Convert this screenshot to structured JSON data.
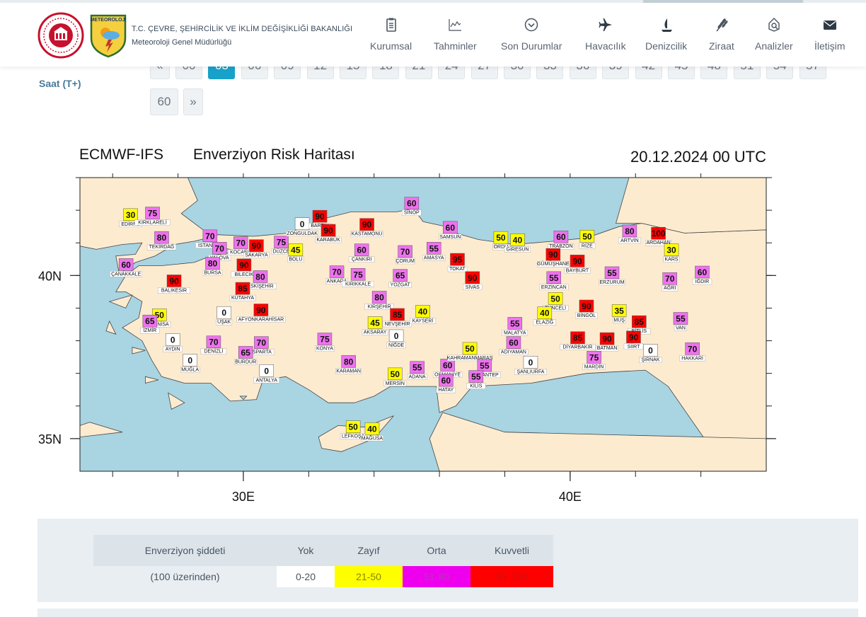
{
  "header": {
    "org_line1": "T.C. ÇEVRE, ŞEHİRCİLİK VE İKLİM DEĞİŞİKLİĞİ BAKANLIĞI",
    "org_line2": "Meteoroloji Genel Müdürlüğü",
    "logo2_text": "METEOROLOJİ",
    "nav": [
      {
        "label": "Kurumsal",
        "icon": "clipboard-icon"
      },
      {
        "label": "Tahminler",
        "icon": "chart-icon"
      },
      {
        "label": "Son Durumlar",
        "icon": "chevron-circle-icon"
      },
      {
        "label": "Havacılık",
        "icon": "airplane-icon"
      },
      {
        "label": "Denizcilik",
        "icon": "sailboat-icon"
      },
      {
        "label": "Ziraat",
        "icon": "wheat-icon"
      },
      {
        "label": "Analizler",
        "icon": "magnifier-icon"
      },
      {
        "label": "İletişim",
        "icon": "envelope-icon"
      }
    ]
  },
  "pager": {
    "label": "Saat (T+)",
    "prev": "«",
    "next": "»",
    "hours": [
      "00",
      "03",
      "06",
      "09",
      "12",
      "15",
      "18",
      "21",
      "24",
      "27",
      "30",
      "33",
      "36",
      "39",
      "42",
      "45",
      "48",
      "51",
      "54",
      "57",
      "60"
    ],
    "active": "03"
  },
  "map": {
    "model": "ECMWF-IFS",
    "title": "Enverziyon Risk Haritası",
    "datetime": "20.12.2024 00 UTC",
    "lat_labels": [
      "40N",
      "35N"
    ],
    "lon_labels": [
      "30E",
      "40E"
    ],
    "colors": {
      "sea": "#a9d4e2",
      "land": "#fdebd0",
      "yok": "#ffffff",
      "zayif": "#ffff00",
      "orta": "#ee72ee",
      "kuvvetli": "#ff0000"
    },
    "stations": [
      {
        "name": "EDİRNE",
        "v": 30,
        "lon": 26.55,
        "lat": 41.68
      },
      {
        "name": "KIRKLARELİ",
        "v": 75,
        "lon": 27.22,
        "lat": 41.73
      },
      {
        "name": "TEKİRDAĞ",
        "v": 80,
        "lon": 27.5,
        "lat": 40.98
      },
      {
        "name": "İSTANBUL",
        "v": 70,
        "lon": 28.98,
        "lat": 41.03
      },
      {
        "name": "YALOVA",
        "v": 70,
        "lon": 29.27,
        "lat": 40.65
      },
      {
        "name": "KOCAELİ",
        "v": 70,
        "lon": 29.92,
        "lat": 40.82
      },
      {
        "name": "SAKARYA",
        "v": 90,
        "lon": 30.4,
        "lat": 40.73
      },
      {
        "name": "DÜZCE",
        "v": 75,
        "lon": 31.16,
        "lat": 40.84
      },
      {
        "name": "BOLU",
        "v": 45,
        "lon": 31.6,
        "lat": 40.6
      },
      {
        "name": "ZONGULDAK",
        "v": 0,
        "lon": 31.8,
        "lat": 41.4
      },
      {
        "name": "BARTIN",
        "v": 90,
        "lon": 32.34,
        "lat": 41.63
      },
      {
        "name": "KARABÜK",
        "v": 90,
        "lon": 32.6,
        "lat": 41.2
      },
      {
        "name": "KASTAMONU",
        "v": 90,
        "lon": 33.78,
        "lat": 41.38
      },
      {
        "name": "SİNOP",
        "v": 60,
        "lon": 35.15,
        "lat": 42.03
      },
      {
        "name": "ÇANAKKALE",
        "v": 60,
        "lon": 26.41,
        "lat": 40.15
      },
      {
        "name": "BALIKESİR",
        "v": 90,
        "lon": 27.88,
        "lat": 39.65
      },
      {
        "name": "BURSA",
        "v": 80,
        "lon": 29.06,
        "lat": 40.19
      },
      {
        "name": "BİLECİK",
        "v": 90,
        "lon": 30.02,
        "lat": 40.14
      },
      {
        "name": "ESKİŞEHİR",
        "v": 80,
        "lon": 30.52,
        "lat": 39.78
      },
      {
        "name": "KÜTAHYA",
        "v": 85,
        "lon": 29.98,
        "lat": 39.42
      },
      {
        "name": "ÇANKIRI",
        "v": 60,
        "lon": 33.62,
        "lat": 40.6
      },
      {
        "name": "ÇORUM",
        "v": 70,
        "lon": 34.95,
        "lat": 40.55
      },
      {
        "name": "AMASYA",
        "v": 55,
        "lon": 35.83,
        "lat": 40.65
      },
      {
        "name": "SAMSUN",
        "v": 60,
        "lon": 36.33,
        "lat": 41.29
      },
      {
        "name": "TOKAT",
        "v": 95,
        "lon": 36.55,
        "lat": 40.31
      },
      {
        "name": "ANKARA",
        "v": 70,
        "lon": 32.86,
        "lat": 39.93
      },
      {
        "name": "KIRIKKALE",
        "v": 75,
        "lon": 33.51,
        "lat": 39.85
      },
      {
        "name": "YOZGAT",
        "v": 65,
        "lon": 34.8,
        "lat": 39.82
      },
      {
        "name": "SİVAS",
        "v": 90,
        "lon": 37.01,
        "lat": 39.75
      },
      {
        "name": "ORDU",
        "v": 50,
        "lon": 37.88,
        "lat": 40.98
      },
      {
        "name": "GİRESUN",
        "v": 40,
        "lon": 38.39,
        "lat": 40.91
      },
      {
        "name": "TRABZON",
        "v": 60,
        "lon": 39.72,
        "lat": 41.0
      },
      {
        "name": "RİZE",
        "v": 50,
        "lon": 40.52,
        "lat": 41.02
      },
      {
        "name": "ARTVİN",
        "v": 80,
        "lon": 41.82,
        "lat": 41.18
      },
      {
        "name": "ARDAHAN",
        "v": 100,
        "lon": 42.7,
        "lat": 41.11
      },
      {
        "name": "KARS",
        "v": 30,
        "lon": 43.1,
        "lat": 40.6
      },
      {
        "name": "GÜMÜŞHANE",
        "v": 90,
        "lon": 39.48,
        "lat": 40.46
      },
      {
        "name": "BAYBURT",
        "v": 90,
        "lon": 40.22,
        "lat": 40.26
      },
      {
        "name": "ERZİNCAN",
        "v": 55,
        "lon": 39.5,
        "lat": 39.75
      },
      {
        "name": "ERZURUM",
        "v": 55,
        "lon": 41.28,
        "lat": 39.9
      },
      {
        "name": "IĞDIR",
        "v": 60,
        "lon": 44.04,
        "lat": 39.92
      },
      {
        "name": "AĞRI",
        "v": 70,
        "lon": 43.05,
        "lat": 39.72
      },
      {
        "name": "TUNCELİ",
        "v": 50,
        "lon": 39.55,
        "lat": 39.11
      },
      {
        "name": "BİNGÖL",
        "v": 90,
        "lon": 40.5,
        "lat": 38.88
      },
      {
        "name": "MUŞ",
        "v": 35,
        "lon": 41.5,
        "lat": 38.74
      },
      {
        "name": "BİTLİS",
        "v": 85,
        "lon": 42.11,
        "lat": 38.4
      },
      {
        "name": "VAN",
        "v": 55,
        "lon": 43.38,
        "lat": 38.5
      },
      {
        "name": "ELAZIĞ",
        "v": 40,
        "lon": 39.22,
        "lat": 38.67
      },
      {
        "name": "MALATYA",
        "v": 55,
        "lon": 38.31,
        "lat": 38.35
      },
      {
        "name": "KIRŞEHİR",
        "v": 80,
        "lon": 34.16,
        "lat": 39.15
      },
      {
        "name": "NEVŞEHİR",
        "v": 85,
        "lon": 34.71,
        "lat": 38.62
      },
      {
        "name": "KAYSERİ",
        "v": 40,
        "lon": 35.49,
        "lat": 38.72
      },
      {
        "name": "AKSARAY",
        "v": 45,
        "lon": 34.03,
        "lat": 38.37
      },
      {
        "name": "NİĞDE",
        "v": 0,
        "lon": 34.68,
        "lat": 37.97
      },
      {
        "name": "AFYONKARAHİSAR",
        "v": 90,
        "lon": 30.54,
        "lat": 38.76
      },
      {
        "name": "UŞAK",
        "v": 0,
        "lon": 29.41,
        "lat": 38.68
      },
      {
        "name": "MANİSA",
        "v": 50,
        "lon": 27.43,
        "lat": 38.61
      },
      {
        "name": "İZMİR",
        "v": 65,
        "lon": 27.14,
        "lat": 38.42
      },
      {
        "name": "AYDIN",
        "v": 0,
        "lon": 27.84,
        "lat": 37.85
      },
      {
        "name": "DENİZLİ",
        "v": 70,
        "lon": 29.09,
        "lat": 37.78
      },
      {
        "name": "ISPARTA",
        "v": 70,
        "lon": 30.55,
        "lat": 37.76
      },
      {
        "name": "BURDUR",
        "v": 65,
        "lon": 30.07,
        "lat": 37.46
      },
      {
        "name": "MUĞLA",
        "v": 0,
        "lon": 28.37,
        "lat": 37.22
      },
      {
        "name": "ANTALYA",
        "v": 0,
        "lon": 30.71,
        "lat": 36.9
      },
      {
        "name": "KONYA",
        "v": 75,
        "lon": 32.49,
        "lat": 37.87
      },
      {
        "name": "KARAMAN",
        "v": 80,
        "lon": 33.22,
        "lat": 37.18
      },
      {
        "name": "MERSİN",
        "v": 50,
        "lon": 34.64,
        "lat": 36.8
      },
      {
        "name": "ADANA",
        "v": 55,
        "lon": 35.32,
        "lat": 37.0
      },
      {
        "name": "OSMANİYE",
        "v": 60,
        "lon": 36.25,
        "lat": 37.07
      },
      {
        "name": "KAHRAMANMARAŞ",
        "v": 50,
        "lon": 36.93,
        "lat": 37.58
      },
      {
        "name": "GAZİANTEP",
        "v": 55,
        "lon": 37.38,
        "lat": 37.06
      },
      {
        "name": "KİLİS",
        "v": 55,
        "lon": 37.12,
        "lat": 36.72
      },
      {
        "name": "HATAY",
        "v": 60,
        "lon": 36.2,
        "lat": 36.6
      },
      {
        "name": "ADIYAMAN",
        "v": 60,
        "lon": 38.27,
        "lat": 37.76
      },
      {
        "name": "ŞANLIURFA",
        "v": 0,
        "lon": 38.79,
        "lat": 37.16
      },
      {
        "name": "DİYARBAKIR",
        "v": 85,
        "lon": 40.23,
        "lat": 37.91
      },
      {
        "name": "BATMAN",
        "v": 90,
        "lon": 41.13,
        "lat": 37.88
      },
      {
        "name": "SİİRT",
        "v": 90,
        "lon": 41.94,
        "lat": 37.93
      },
      {
        "name": "MARDİN",
        "v": 75,
        "lon": 40.73,
        "lat": 37.31
      },
      {
        "name": "ŞIRNAK",
        "v": 0,
        "lon": 42.46,
        "lat": 37.52
      },
      {
        "name": "HAKKARİ",
        "v": 70,
        "lon": 43.74,
        "lat": 37.57
      },
      {
        "name": "LEFKOŞA",
        "v": 50,
        "lon": 33.36,
        "lat": 35.18
      },
      {
        "name": "MAĞUSA",
        "v": 40,
        "lon": 33.94,
        "lat": 35.12
      }
    ]
  },
  "legend": {
    "header": [
      "Enverziyon şiddeti",
      "Yok",
      "Zayıf",
      "Orta",
      "Kuvvetli"
    ],
    "row": [
      "(100 üzerinden)",
      "0-20",
      "21-50",
      "51-80",
      "81-100"
    ]
  }
}
